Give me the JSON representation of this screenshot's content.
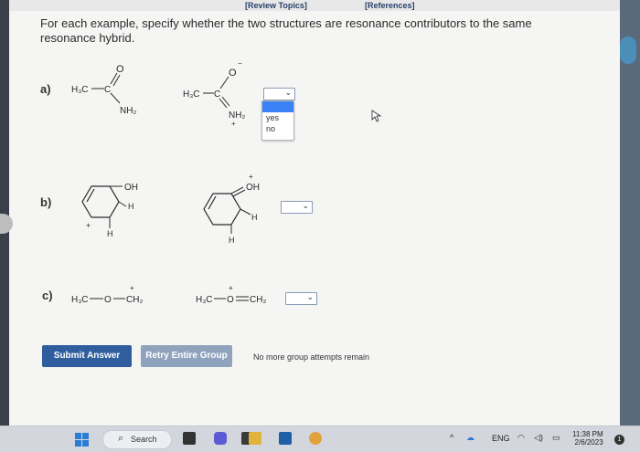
{
  "header": {
    "review_topics": "[Review Topics]",
    "references": "[References]"
  },
  "instruction": "For each example, specify whether the two structures are resonance contributors to the same resonance hybrid.",
  "problems": {
    "a": {
      "label": "a)",
      "left": {
        "methyl": "H₃C",
        "heteroatom": "O",
        "amine": "NH₂"
      },
      "right": {
        "methyl": "H₃C",
        "heteroatom": "O",
        "amine": "NH₂",
        "charge_o": "−",
        "charge_n": "+"
      },
      "dropdown_options": [
        "yes",
        "no"
      ]
    },
    "b": {
      "label": "b)",
      "left": {
        "hydroxyl": "OH",
        "hydrogen_ring": "H",
        "hydrogen_sub": "H",
        "charge": "+"
      },
      "right": {
        "hydroxyl": "OH",
        "hydrogen_ring": "H",
        "hydrogen_sub": "H",
        "charge": "+"
      }
    },
    "c": {
      "label": "c)",
      "left": {
        "methyl": "H₃C",
        "oxygen": "O",
        "methylene": "CH₂",
        "charge": "+"
      },
      "right": {
        "methyl": "H₃C",
        "oxygen": "O",
        "methylene": "CH₂",
        "charge": "+"
      }
    }
  },
  "buttons": {
    "submit": "Submit Answer",
    "retry": "Retry Entire Group"
  },
  "status": "No more group attempts remain",
  "taskbar": {
    "search": "Search",
    "language": "ENG",
    "time": "11:38 PM",
    "date": "2/6/2023",
    "notification_count": "1"
  },
  "colors": {
    "submit_bg": "#2f5d9e",
    "retry_bg": "#8fa3bd",
    "dropdown_highlight": "#3b82f6"
  }
}
